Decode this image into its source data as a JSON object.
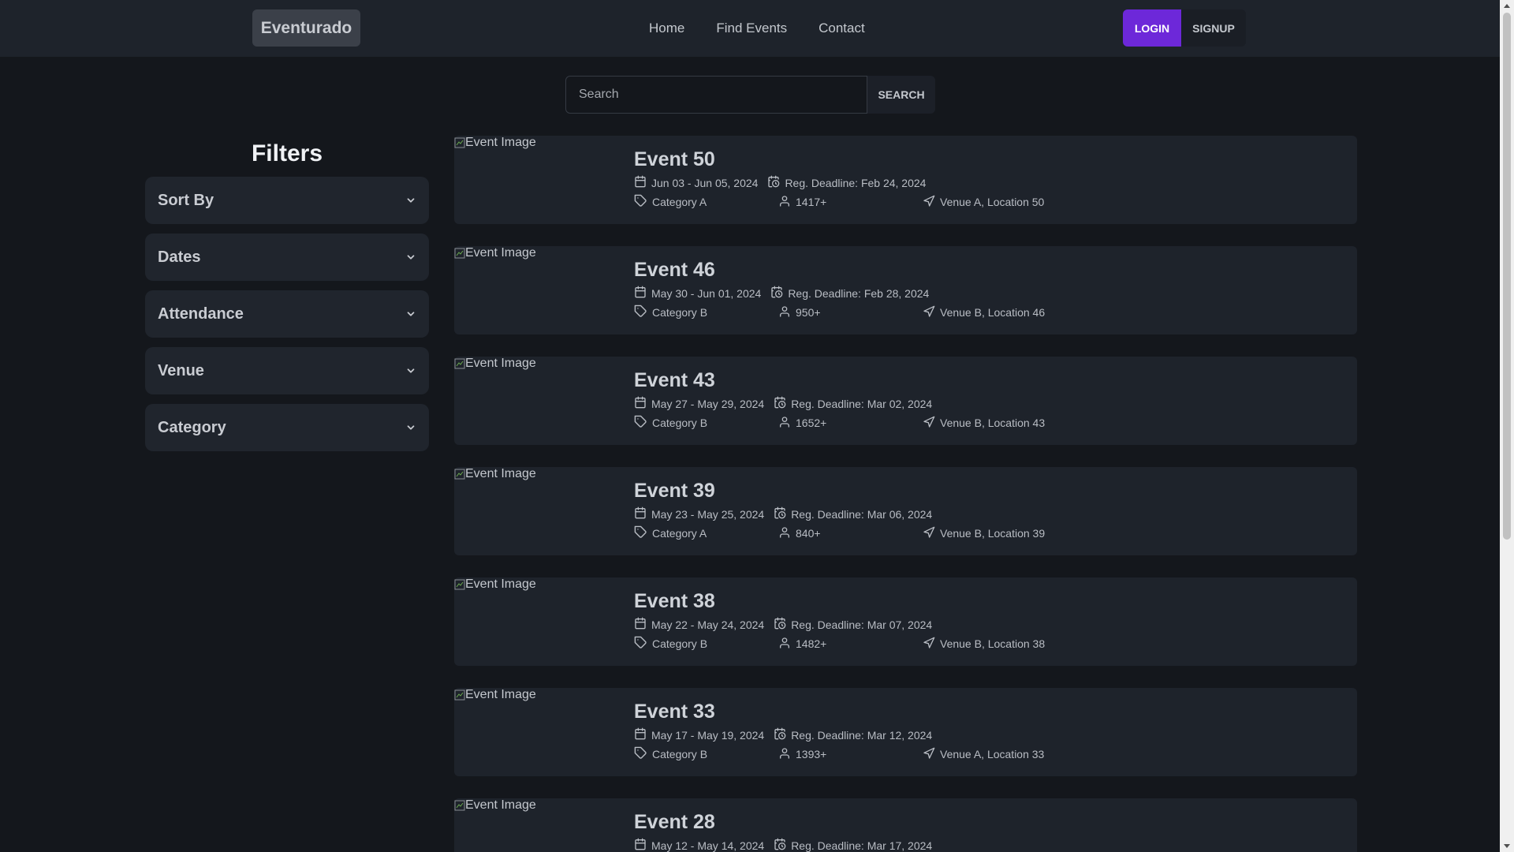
{
  "nav": {
    "brand": "Eventurado",
    "links": [
      "Home",
      "Find Events",
      "Contact"
    ],
    "login": "LOGIN",
    "signup": "SIGNUP"
  },
  "search": {
    "placeholder": "Search",
    "value": "",
    "button": "SEARCH"
  },
  "filters": {
    "title": "Filters",
    "items": [
      "Sort By",
      "Dates",
      "Attendance",
      "Venue",
      "Category"
    ]
  },
  "events": [
    {
      "title": "Event 50",
      "image_alt": "Event Image",
      "dates": "Jun 03 - Jun 05, 2024",
      "deadline": "Reg. Deadline: Feb 24, 2024",
      "category": "Category A",
      "attendance": "1417+",
      "venue": "Venue A, Location 50"
    },
    {
      "title": "Event 46",
      "image_alt": "Event Image",
      "dates": "May 30 - Jun 01, 2024",
      "deadline": "Reg. Deadline: Feb 28, 2024",
      "category": "Category B",
      "attendance": "950+",
      "venue": "Venue B, Location 46"
    },
    {
      "title": "Event 43",
      "image_alt": "Event Image",
      "dates": "May 27 - May 29, 2024",
      "deadline": "Reg. Deadline: Mar 02, 2024",
      "category": "Category B",
      "attendance": "1652+",
      "venue": "Venue B, Location 43"
    },
    {
      "title": "Event 39",
      "image_alt": "Event Image",
      "dates": "May 23 - May 25, 2024",
      "deadline": "Reg. Deadline: Mar 06, 2024",
      "category": "Category A",
      "attendance": "840+",
      "venue": "Venue B, Location 39"
    },
    {
      "title": "Event 38",
      "image_alt": "Event Image",
      "dates": "May 22 - May 24, 2024",
      "deadline": "Reg. Deadline: Mar 07, 2024",
      "category": "Category B",
      "attendance": "1482+",
      "venue": "Venue B, Location 38"
    },
    {
      "title": "Event 33",
      "image_alt": "Event Image",
      "dates": "May 17 - May 19, 2024",
      "deadline": "Reg. Deadline: Mar 12, 2024",
      "category": "Category B",
      "attendance": "1393+",
      "venue": "Venue A, Location 33"
    },
    {
      "title": "Event 28",
      "image_alt": "Event Image",
      "dates": "May 12 - May 14, 2024",
      "deadline": "Reg. Deadline: Mar 17, 2024",
      "category": "",
      "attendance": "",
      "venue": ""
    }
  ],
  "icons": {
    "brand_color": "#6d28d9",
    "calendar": "calendar-icon",
    "deadline": "calendar-clock-icon",
    "category": "tag-icon",
    "attendance": "user-icon",
    "venue": "navigation-icon",
    "filter_toggle": "chevron-down-icon"
  }
}
